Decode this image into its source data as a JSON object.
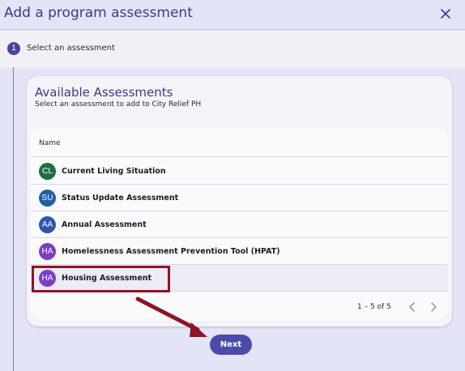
{
  "dialog": {
    "title": "Add a program assessment",
    "close_icon": "close-icon"
  },
  "stepper": {
    "step_number": "1",
    "step_label": "Select an assessment"
  },
  "card": {
    "title": "Available Assessments",
    "subtitle": "Select an assessment to add to City Relief PH"
  },
  "table": {
    "column_header": "Name",
    "rows": [
      {
        "initials": "CL",
        "label": "Current Living Situation",
        "color": "#1f6e42"
      },
      {
        "initials": "SU",
        "label": "Status Update Assessment",
        "color": "#1f5fa8"
      },
      {
        "initials": "AA",
        "label": "Annual Assessment",
        "color": "#2f55b0"
      },
      {
        "initials": "HA",
        "label": "Homelessness Assessment Prevention Tool (HPAT)",
        "color": "#7a3ec6"
      },
      {
        "initials": "HA",
        "label": "Housing Assessment",
        "color": "#7a3ec6"
      }
    ]
  },
  "pagination": {
    "range_label": "1 – 5 of 5"
  },
  "footer": {
    "next_label": "Next"
  },
  "colors": {
    "accent": "#4b4bab",
    "highlight": "#8b1624",
    "header_bg": "#e4e4f7"
  }
}
